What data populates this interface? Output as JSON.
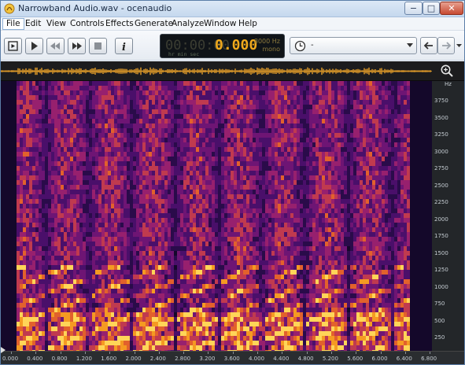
{
  "window": {
    "title": "Narrowband Audio.wav - ocenaudio",
    "minimize": "−",
    "maximize": "□",
    "close": "✕"
  },
  "menu": {
    "items": [
      "File",
      "Edit",
      "View",
      "Controls",
      "Effects",
      "Generate",
      "Analyze",
      "Window",
      "Help"
    ],
    "active": "File"
  },
  "toolbar": {
    "icons": [
      "play-selection-icon",
      "play-icon",
      "rewind-icon",
      "fast-forward-icon",
      "stop-icon",
      "info-icon"
    ],
    "display": {
      "dim_digits": "00:00:00",
      "time": "0.000",
      "units": "hr   min  sec",
      "sample_rate": "8000 Hz",
      "channels": "mono"
    },
    "history_select": {
      "value": "-",
      "icon": "clock-icon"
    },
    "back_icon": "arrow-left-icon",
    "forward_icon": "arrow-right-icon"
  },
  "colors": {
    "accent_orange": "#f0a81c",
    "waveform": "#e8a02a",
    "spectrogram_low": "#0a0613",
    "spectrogram_high": "#ffe070"
  },
  "frequency_axis": {
    "unit": "Hz",
    "ticks": [
      "3750",
      "3500",
      "3250",
      "3000",
      "2750",
      "2500",
      "2250",
      "2000",
      "1750",
      "1500",
      "1250",
      "1000",
      "750",
      "500",
      "250"
    ]
  },
  "time_axis": {
    "ticks": [
      "0.000",
      "0.400",
      "0.800",
      "1.200",
      "1.600",
      "2.000",
      "2.400",
      "2.800",
      "3.200",
      "3.600",
      "4.000",
      "4.400",
      "4.800",
      "5.200",
      "5.600",
      "6.000",
      "6.400",
      "6.800"
    ]
  }
}
